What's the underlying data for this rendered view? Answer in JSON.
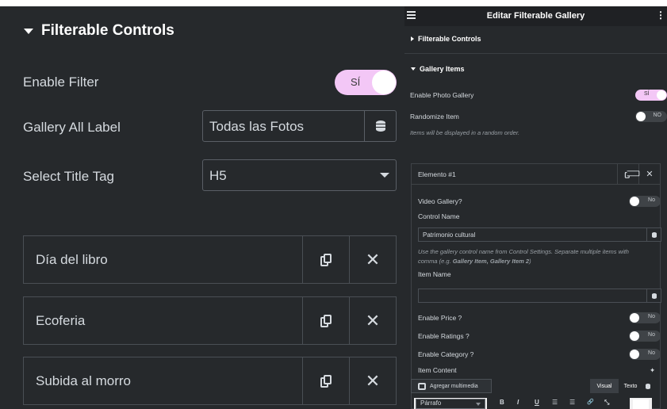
{
  "left": {
    "section_title": "Filterable Controls",
    "enable_filter_label": "Enable Filter",
    "enable_filter_toggle": "SÍ",
    "gallery_all_label": "Gallery All Label",
    "gallery_all_value": "Todas las Fotos",
    "select_title_tag_label": "Select Title Tag",
    "select_title_tag_value": "H5",
    "items": [
      "Día del libro",
      "Ecoferia",
      "Subida al morro"
    ]
  },
  "right": {
    "panel_title": "Editar Filterable Gallery",
    "section_filterable": "Filterable Controls",
    "section_gallery_items": "Gallery Items",
    "enable_photo_gallery": "Enable Photo Gallery",
    "enable_photo_gallery_toggle": "SÍ",
    "randomize_item": "Randomize Item",
    "randomize_toggle": "NO",
    "randomize_note": "Items will be displayed in a random order.",
    "item_header": "Elemento #1",
    "video_gallery": "Video Gallery?",
    "video_gallery_toggle": "No",
    "control_name_label": "Control Name",
    "control_name_value": "Patrimonio cultural",
    "control_note_1": "Use the gallery control name from Control Settings. Separate multiple items with",
    "control_note_2_prefix": "comma (e.g. ",
    "control_note_2_bold": "Gallery Item, Gallery Item 2",
    "control_note_2_suffix": ")",
    "item_name_label": "Item Name",
    "enable_price": "Enable Price ?",
    "enable_price_toggle": "No",
    "enable_ratings": "Enable Ratings ?",
    "enable_ratings_toggle": "No",
    "enable_category": "Enable Category ?",
    "enable_category_toggle": "No",
    "item_content": "Item Content",
    "add_media": "Agregar multimedia",
    "tab_visual": "Visual",
    "tab_texto": "Texto",
    "format_select": "Párrafo",
    "fmt_bold": "B",
    "fmt_italic": "I",
    "fmt_underline": "U",
    "fmt_ul": "☰",
    "fmt_ol": "☰",
    "fmt_link": "🔗",
    "fmt_expand": "⤡",
    "ai_icon": "✦"
  },
  "colors": {
    "panel_bg": "#26292c",
    "toggle_on": "#f3c7f6",
    "toggle_off": "#3f4347",
    "text": "#d5dadf"
  }
}
